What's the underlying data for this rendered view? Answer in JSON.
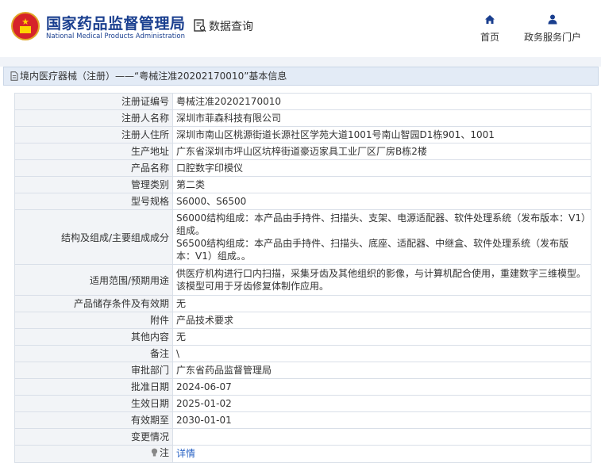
{
  "header": {
    "title_cn": "国家药品监督管理局",
    "title_en": "National Medical Products Administration",
    "query_label": "数据查询",
    "nav": [
      {
        "label": "首页",
        "icon": "home-icon"
      },
      {
        "label": "政务服务门户",
        "icon": "user-icon"
      }
    ]
  },
  "breadcrumb": {
    "text": "境内医疗器械（注册）——“粤械注准20202170010”基本信息"
  },
  "table": {
    "rows": [
      {
        "label": "注册证编号",
        "value": "粤械注准20202170010"
      },
      {
        "label": "注册人名称",
        "value": "深圳市菲森科技有限公司"
      },
      {
        "label": "注册人住所",
        "value": "深圳市南山区桃源街道长源社区学苑大道1001号南山智园D1栋901、1001"
      },
      {
        "label": "生产地址",
        "value": "广东省深圳市坪山区坑梓街道豪迈家具工业厂区厂房B栋2楼"
      },
      {
        "label": "产品名称",
        "value": "口腔数字印模仪"
      },
      {
        "label": "管理类别",
        "value": "第二类"
      },
      {
        "label": "型号规格",
        "value": "S6000、S6500"
      },
      {
        "label": "结构及组成/主要组成成分",
        "value": "S6000结构组成：本产品由手持件、扫描头、支架、电源适配器、软件处理系统（发布版本：V1）组成。\nS6500结构组成：本产品由手持件、扫描头、底座、适配器、中继盒、软件处理系统（发布版本：V1）组成。。"
      },
      {
        "label": "适用范围/预期用途",
        "value": "供医疗机构进行口内扫描，采集牙齿及其他组织的影像，与计算机配合使用，重建数字三维模型。该模型可用于牙齿修复体制作应用。"
      },
      {
        "label": "产品储存条件及有效期",
        "value": "无"
      },
      {
        "label": "附件",
        "value": "产品技术要求"
      },
      {
        "label": "其他内容",
        "value": "无"
      },
      {
        "label": "备注",
        "value": "\\"
      },
      {
        "label": "审批部门",
        "value": "广东省药品监督管理局"
      },
      {
        "label": "批准日期",
        "value": "2024-06-07"
      },
      {
        "label": "生效日期",
        "value": "2025-01-02"
      },
      {
        "label": "有效期至",
        "value": "2030-01-01"
      },
      {
        "label": "变更情况",
        "value": ""
      }
    ],
    "note": {
      "label": "注",
      "link": "详情"
    }
  },
  "colors": {
    "brand": "#1a3f8f",
    "link": "#2b64c5",
    "label_bg": "#f2f4f7",
    "breadcrumb_bg": "#e3ebf6"
  }
}
